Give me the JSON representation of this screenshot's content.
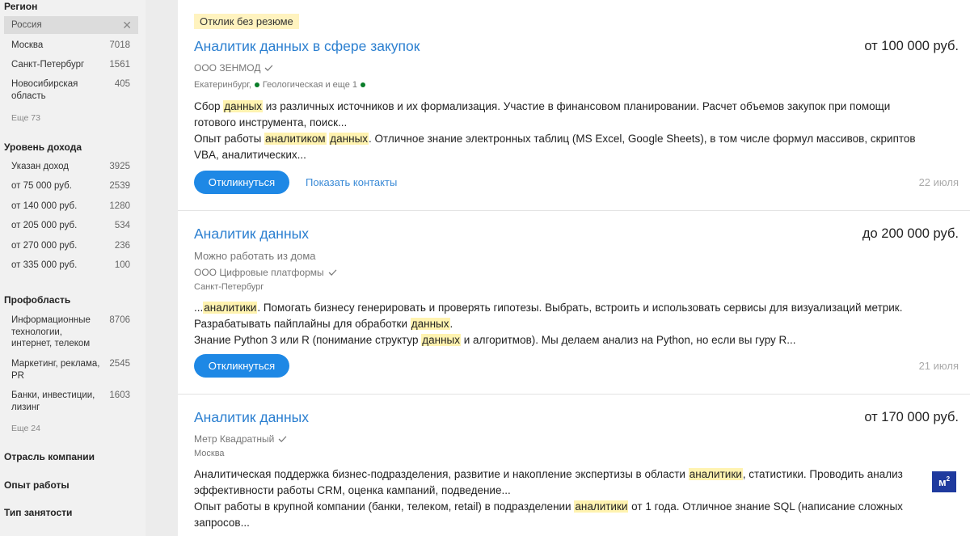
{
  "sidebar": {
    "region_title": "Регион",
    "region_selected": "Россия",
    "region_items": [
      {
        "label": "Москва",
        "count": "7018"
      },
      {
        "label": "Санкт-Петербург",
        "count": "1561"
      },
      {
        "label": "Новосибирская область",
        "count": "405"
      }
    ],
    "region_more": "Еще 73",
    "income_title": "Уровень дохода",
    "income_items": [
      {
        "label": "Указан доход",
        "count": "3925"
      },
      {
        "label": "от 75 000 руб.",
        "count": "2539"
      },
      {
        "label": "от 140 000 руб.",
        "count": "1280"
      },
      {
        "label": "от 205 000 руб.",
        "count": "534"
      },
      {
        "label": "от 270 000 руб.",
        "count": "236"
      },
      {
        "label": "от 335 000 руб.",
        "count": "100"
      }
    ],
    "prof_title": "Профобласть",
    "prof_items": [
      {
        "label": "Информационные технологии, интернет, телеком",
        "count": "8706"
      },
      {
        "label": "Маркетинг, реклама, PR",
        "count": "2545"
      },
      {
        "label": "Банки, инвестиции, лизинг",
        "count": "1603"
      }
    ],
    "prof_more": "Еще 24",
    "industry_title": "Отрасль компании",
    "experience_title": "Опыт работы",
    "employment_title": "Тип занятости"
  },
  "vacancies": [
    {
      "badge": "Отклик без резюме",
      "title": "Аналитик данных в сфере закупок",
      "salary": "от 100 000 руб.",
      "company": "ООО ЗЕНМОД",
      "city": "Екатеринбург,",
      "metro": "Геологическая и еще 1",
      "desc": [
        [
          "Сбор ",
          "данных",
          " из различных источников и их формализация. Участие в финансовом планировании. Расчет объемов закупок при помощи готового инструмента, поиск..."
        ],
        [
          "Опыт работы ",
          "аналитиком",
          " ",
          "данных",
          ". Отличное знание электронных таблиц (MS Excel, Google Sheets), в том числе формул массивов, скриптов VBA, аналитических..."
        ]
      ],
      "apply": "Откликнуться",
      "contacts": "Показать контакты",
      "date": "22 июля"
    },
    {
      "title": "Аналитик данных",
      "salary": "до 200 000 руб.",
      "remote": "Можно работать из дома",
      "company": "ООО Цифровые платформы",
      "city": "Санкт-Петербург",
      "desc": [
        [
          "...",
          "аналитики",
          ". Помогать бизнесу генерировать и проверять гипотезы. Выбрать, встроить и использовать сервисы для визуализаций метрик. Разрабатывать пайплайны для обработки ",
          "данных",
          "."
        ],
        [
          "Знание Python 3 или R (понимание структур ",
          "данных",
          " и алгоритмов). Мы делаем анализ на Python, но если вы гуру R..."
        ]
      ],
      "apply": "Откликнуться",
      "date": "21 июля"
    },
    {
      "title": "Аналитик данных",
      "salary": "от 170 000 руб.",
      "company": "Метр Квадратный",
      "city": "Москва",
      "logo": "м",
      "logo_sup": "2",
      "desc": [
        [
          "Аналитическая поддержка бизнес-подразделения, развитие и накопление экспертизы в области ",
          "аналитики",
          ", статистики. Проводить анализ эффективности работы CRM, оценка кампаний, подведение..."
        ],
        [
          "Опыт работы в крупной компании (банки, телеком, retail) в подразделении ",
          "аналитики",
          " от 1 года. Отличное знание SQL (написание сложных запросов..."
        ]
      ]
    }
  ]
}
